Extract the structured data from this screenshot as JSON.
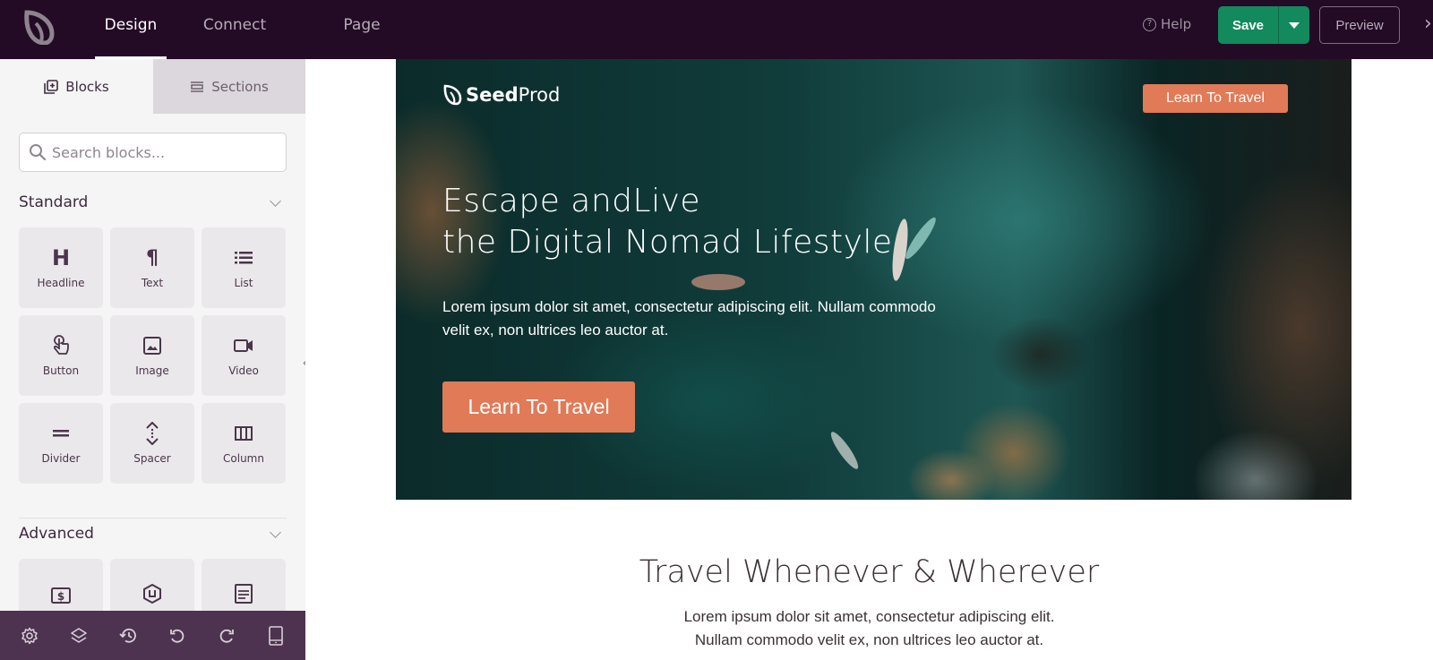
{
  "topbar": {
    "nav": [
      {
        "label": "Design",
        "active": true
      },
      {
        "label": "Connect",
        "active": false
      },
      {
        "label": "Page Settings",
        "active": false
      }
    ],
    "help_label": "Help",
    "save_label": "Save",
    "preview_label": "Preview",
    "close_glyph": "›"
  },
  "sidebar": {
    "tabs": [
      {
        "label": "Blocks",
        "active": true
      },
      {
        "label": "Sections",
        "active": false
      }
    ],
    "search_placeholder": "Search blocks...",
    "standard": {
      "title": "Standard",
      "blocks": [
        {
          "label": "Headline",
          "icon": "headline-icon"
        },
        {
          "label": "Text",
          "icon": "paragraph-icon"
        },
        {
          "label": "List",
          "icon": "list-icon"
        },
        {
          "label": "Button",
          "icon": "pointer-icon"
        },
        {
          "label": "Image",
          "icon": "image-icon"
        },
        {
          "label": "Video",
          "icon": "video-icon"
        },
        {
          "label": "Divider",
          "icon": "divider-icon"
        },
        {
          "label": "Spacer",
          "icon": "spacer-icon"
        },
        {
          "label": "Column",
          "icon": "column-icon"
        }
      ]
    },
    "advanced": {
      "title": "Advanced",
      "blocks": [
        {
          "icon": "pricing-icon"
        },
        {
          "icon": "optin-icon"
        },
        {
          "icon": "form-icon"
        }
      ]
    },
    "bottom_bar": [
      "settings-icon",
      "layers-icon",
      "history-icon",
      "undo-icon",
      "redo-icon",
      "mobile-preview-icon"
    ]
  },
  "canvas": {
    "hero": {
      "logo_bold": "Seed",
      "logo_light": "Prod",
      "nav_button": "Learn To Travel",
      "title_line1": "Escape andLive",
      "title_line2": "the Digital Nomad Lifestyle",
      "text_line1": "Lorem ipsum dolor sit amet, consectetur adipiscing elit. Nullam commodo",
      "text_line2": "velit ex, non ultrices leo auctor at.",
      "cta_button": "Learn To Travel"
    },
    "section2": {
      "title": "Travel Whenever & Wherever",
      "text_line1": "Lorem ipsum dolor sit amet, consectetur adipiscing elit.",
      "text_line2": "Nullam commodo velit ex, non ultrices leo auctor at."
    }
  },
  "colors": {
    "topbar_bg": "#230a25",
    "save_green": "#128a5b",
    "accent_orange": "#e07a57",
    "sidebar_bg": "#f6f5f6",
    "bottom_bar_bg": "#4d334f"
  }
}
